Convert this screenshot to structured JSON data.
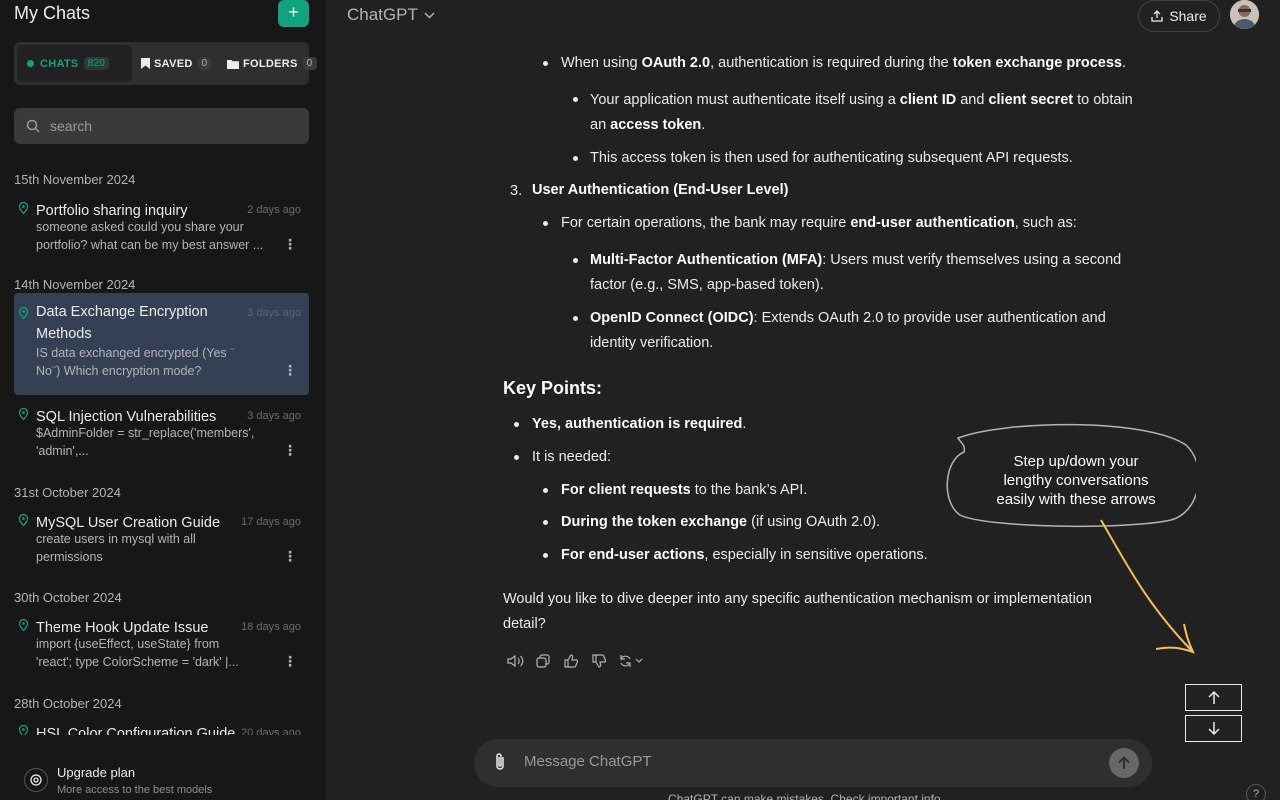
{
  "sidebar": {
    "title": "My Chats",
    "new_chat_icon": "+",
    "tabs": [
      {
        "label": "CHATS",
        "count": "820"
      },
      {
        "label": "SAVED",
        "count": "0"
      },
      {
        "label": "FOLDERS",
        "count": "0"
      }
    ],
    "search_placeholder": "search",
    "groups": [
      {
        "date": "15th November 2024",
        "items": [
          {
            "title": "Portfolio sharing inquiry",
            "time": "2 days ago",
            "preview1": "someone asked could you share your",
            "preview2": "portfolio? what can be my best answer ..."
          }
        ]
      },
      {
        "date": "14th November 2024",
        "items": [
          {
            "title1": "Data Exchange Encryption",
            "title2": "Methods",
            "time": "3 days ago",
            "preview1": "IS data exchanged encrypted (Yes ¨",
            "preview2": "No¨) Which encryption mode?"
          },
          {
            "title": "SQL Injection Vulnerabilities",
            "time": "3 days ago",
            "preview1": "$AdminFolder = str_replace('members',",
            "preview2": "'admin',..."
          }
        ]
      },
      {
        "date": "31st October 2024",
        "items": [
          {
            "title": "MySQL User Creation Guide",
            "time": "17 days ago",
            "preview1": "create users in mysql with all",
            "preview2": "permissions"
          }
        ]
      },
      {
        "date": "30th October 2024",
        "items": [
          {
            "title": "Theme Hook Update Issue",
            "time": "18 days ago",
            "preview1": "import {useEffect, useState} from",
            "preview2": "'react'; type ColorScheme = 'dark' |..."
          }
        ]
      },
      {
        "date": "28th October 2024",
        "items": [
          {
            "title": "HSL Color Configuration Guide",
            "time": "20 days ago"
          }
        ]
      }
    ],
    "upgrade": {
      "title": "Upgrade plan",
      "subtitle": "More access to the best models"
    }
  },
  "header": {
    "model": "ChatGPT",
    "share": "Share"
  },
  "message": {
    "l1_pre": "When using ",
    "l1_b1": "OAuth 2.0",
    "l1_mid": ", authentication is required during the ",
    "l1_b2": "token exchange process",
    "l1_post": ".",
    "l2_pre": "Your application must authenticate itself using a ",
    "l2_b1": "client ID",
    "l2_mid": " and ",
    "l2_b2": "client secret",
    "l2_post": " to obtain",
    "l3_pre": "an ",
    "l3_b1": "access token",
    "l3_post": ".",
    "l4": "This access token is then used for authenticating subsequent API requests.",
    "n3": "3.",
    "h3": "User Authentication (End-User Level)",
    "l5_pre": "For certain operations, the bank may require ",
    "l5_b1": "end-user authentication",
    "l5_post": ", such as:",
    "l6_b1": "Multi-Factor Authentication (MFA)",
    "l6_post": ": Users must verify themselves using a second",
    "l7": "factor (e.g., SMS, app-based token).",
    "l8_b1": "OpenID Connect (OIDC)",
    "l8_post": ": Extends OAuth 2.0 to provide user authentication and",
    "l9": "identity verification.",
    "key_points": "Key Points:",
    "k1_b1": "Yes, authentication is required",
    "k1_post": ".",
    "k2": "It is needed:",
    "k3_b1": "For client requests",
    "k3_post": " to the bank’s API.",
    "k4_b1": "During the token exchange",
    "k4_post": " (if using OAuth 2.0).",
    "k5_b1": "For end-user actions",
    "k5_post": ", especially in sensitive operations.",
    "f1": "Would you like to dive deeper into any specific authentication mechanism or implementation",
    "f2": "detail?"
  },
  "callout": {
    "line1": "Step up/down your",
    "line2": "lengthy conversations",
    "line3": "easily with these arrows"
  },
  "composer": {
    "placeholder": "Message ChatGPT",
    "disclaimer": "ChatGPT can make mistakes. Check important info."
  },
  "help": "?",
  "colors": {
    "accent": "#10a37f",
    "selected": "#344154",
    "annotation": "#f5c14b"
  }
}
